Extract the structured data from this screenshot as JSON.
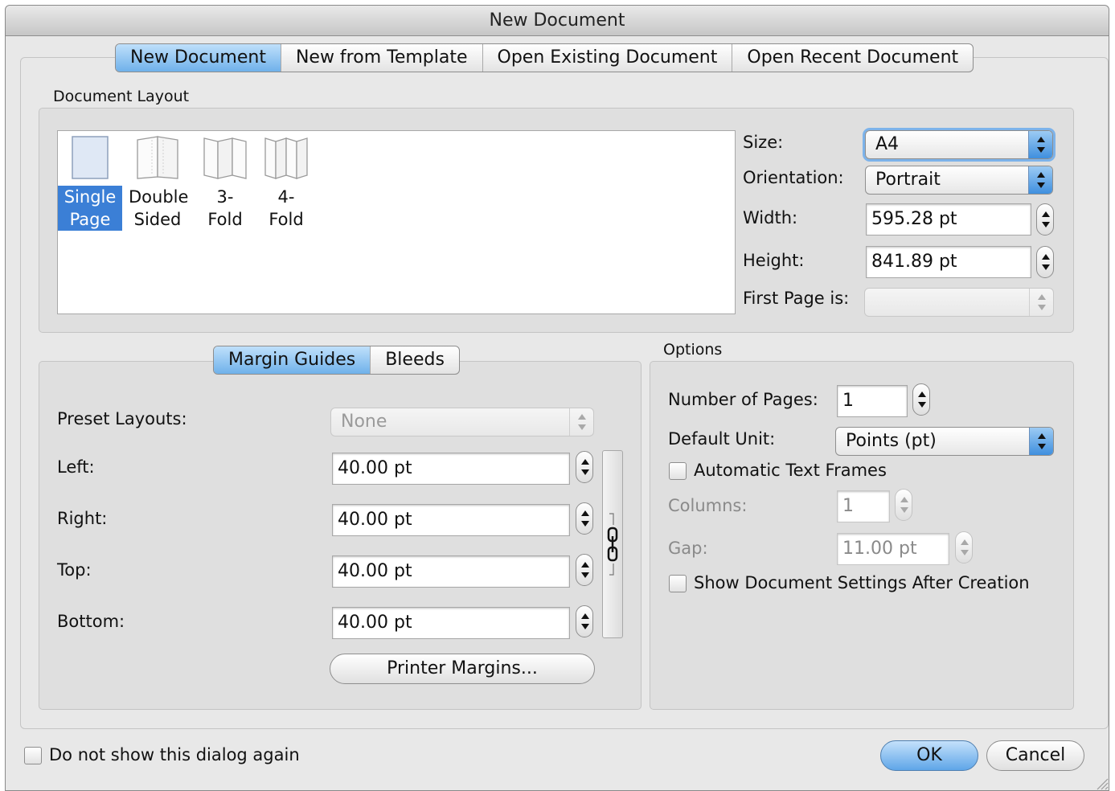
{
  "window": {
    "title": "New Document"
  },
  "tabs": [
    {
      "label": "New Document",
      "active": true
    },
    {
      "label": "New from Template",
      "active": false
    },
    {
      "label": "Open Existing Document",
      "active": false
    },
    {
      "label": "Open Recent Document",
      "active": false
    }
  ],
  "document_layout": {
    "group_title": "Document Layout",
    "layouts": [
      {
        "line1": "Single",
        "line2": "Page",
        "selected": true,
        "icon": "single-page-icon"
      },
      {
        "line1": "Double",
        "line2": "Sided",
        "selected": false,
        "icon": "double-sided-icon"
      },
      {
        "line1": "3-",
        "line2": "Fold",
        "selected": false,
        "icon": "three-fold-icon"
      },
      {
        "line1": "4-",
        "line2": "Fold",
        "selected": false,
        "icon": "four-fold-icon"
      }
    ],
    "size_label": "Size:",
    "size_value": "A4",
    "orientation_label": "Orientation:",
    "orientation_value": "Portrait",
    "width_label": "Width:",
    "width_value": "595.28 pt",
    "height_label": "Height:",
    "height_value": "841.89 pt",
    "first_page_label": "First Page is:",
    "first_page_value": ""
  },
  "margins": {
    "tabs": [
      {
        "label": "Margin Guides",
        "active": true
      },
      {
        "label": "Bleeds",
        "active": false
      }
    ],
    "preset_label": "Preset Layouts:",
    "preset_value": "None",
    "left_label": "Left:",
    "left_value": "40.00 pt",
    "right_label": "Right:",
    "right_value": "40.00 pt",
    "top_label": "Top:",
    "top_value": "40.00 pt",
    "bottom_label": "Bottom:",
    "bottom_value": "40.00 pt",
    "printer_margins_label": "Printer Margins..."
  },
  "options": {
    "group_title": "Options",
    "pages_label": "Number of Pages:",
    "pages_value": "1",
    "unit_label": "Default Unit:",
    "unit_value": "Points (pt)",
    "auto_frames_label": "Automatic Text Frames",
    "auto_frames_checked": false,
    "columns_label": "Columns:",
    "columns_value": "1",
    "gap_label": "Gap:",
    "gap_value": "11.00 pt",
    "show_settings_label": "Show Document Settings After Creation",
    "show_settings_checked": false
  },
  "footer": {
    "dont_show_label": "Do not show this dialog again",
    "dont_show_checked": false,
    "ok_label": "OK",
    "cancel_label": "Cancel"
  },
  "colors": {
    "accent": "#3b7fd6",
    "default_button": "#5fa6e8",
    "window_bg": "#e8e8e8"
  }
}
